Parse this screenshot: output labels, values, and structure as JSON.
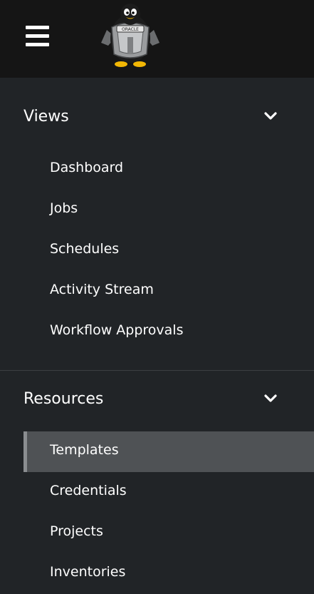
{
  "header": {
    "menu_icon": "hamburger-menu-icon",
    "logo_icon": "tux-penguin-oracle-logo"
  },
  "nav": {
    "groups": [
      {
        "title": "Views",
        "expanded_icon": "chevron-down-icon",
        "items": [
          {
            "label": "Dashboard"
          },
          {
            "label": "Jobs"
          },
          {
            "label": "Schedules"
          },
          {
            "label": "Activity Stream"
          },
          {
            "label": "Workflow Approvals"
          }
        ]
      },
      {
        "title": "Resources",
        "expanded_icon": "chevron-down-icon",
        "items": [
          {
            "label": "Templates",
            "active": true
          },
          {
            "label": "Credentials"
          },
          {
            "label": "Projects"
          },
          {
            "label": "Inventories"
          }
        ]
      }
    ]
  },
  "colors": {
    "header_bg": "#151515",
    "nav_bg": "#212427",
    "active_bg": "#4f5255",
    "active_marker": "#8a8d90",
    "text": "#ffffff"
  }
}
